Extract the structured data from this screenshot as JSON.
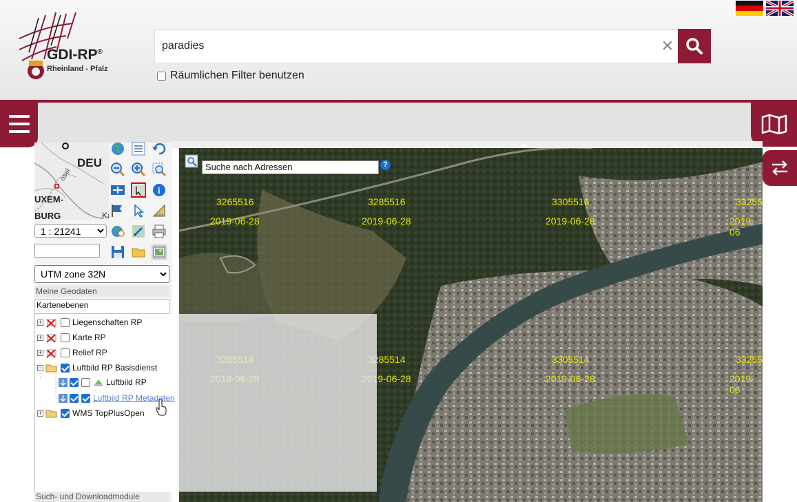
{
  "brand": {
    "title": "GDI-RP",
    "reg": "®",
    "subtitle": "Rheinland - Pfalz"
  },
  "search": {
    "value": "paradies",
    "placeholder": ""
  },
  "filter": {
    "label": "Räumlichen Filter benutzen",
    "checked": false
  },
  "languages": [
    "de-flag-icon",
    "uk-flag-icon"
  ],
  "colors": {
    "accent": "#8e1b36",
    "link": "#5b7fd6",
    "grid_text": "#e8e600",
    "checkbox": "#1a6fd6"
  },
  "overview_map": {
    "labels": [
      "DEU",
      "UXEM-",
      "BURG",
      "osel",
      "Ka"
    ]
  },
  "scale": {
    "value": "1 : 21241"
  },
  "crs": {
    "value": "UTM zone 32N"
  },
  "panel": {
    "section_geodaten": "Meine Geodaten",
    "tab_kartenebenen": "Kartenebenen",
    "section_download": "Such- und Downloadmodule"
  },
  "layers": [
    {
      "label": "Liegenschaften RP",
      "checked": false,
      "expander": "+"
    },
    {
      "label": "Karte RP",
      "checked": false,
      "expander": "+"
    },
    {
      "label": "Relief RP",
      "checked": false,
      "expander": "+"
    },
    {
      "label": "Luftbild RP Basisdienst",
      "checked": true,
      "expander": "−"
    },
    {
      "label": "Luftbild RP",
      "checked": true,
      "checked2": false
    },
    {
      "label": "Luftbild RP Metadaten",
      "checked": true,
      "checked2": true
    },
    {
      "label": "WMS TopPlusOpen",
      "checked": true,
      "expander": "+"
    }
  ],
  "map": {
    "address_search": "Suche nach Adressen",
    "help": "?",
    "grid_labels": [
      {
        "number": "3265516",
        "date": "2019-06-28"
      },
      {
        "number": "3285516",
        "date": "2019-06-28"
      },
      {
        "number": "3305516",
        "date": "2019-06-28"
      },
      {
        "number": "33255",
        "date": "2019-06"
      },
      {
        "number": "3265514",
        "date": "2019-06-28"
      },
      {
        "number": "3285514",
        "date": "2019-06-28"
      },
      {
        "number": "3305514",
        "date": "2019-06-28"
      },
      {
        "number": "33255",
        "date": "2019-06"
      }
    ]
  },
  "tools": [
    "globe-icon",
    "legend-list-icon",
    "history-back-icon",
    "zoom-out-icon",
    "zoom-in-icon",
    "zoom-box-icon",
    "pan-icon",
    "select-feature-icon",
    "info-icon",
    "flag-icon",
    "pointer-icon",
    "measure-icon",
    "globe-search-icon",
    "edit-icon",
    "print-icon",
    "save-icon",
    "open-folder-icon",
    "image-export-icon"
  ]
}
